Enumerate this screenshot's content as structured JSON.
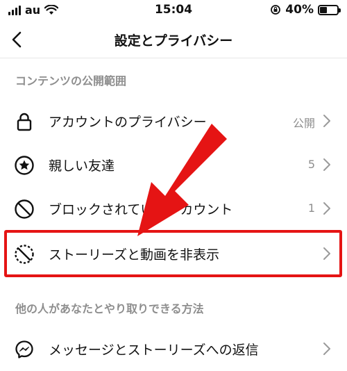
{
  "status_bar": {
    "carrier": "au",
    "time": "15:04",
    "battery_percent": "40%",
    "battery_level": 0.4
  },
  "nav": {
    "title": "設定とプライバシー",
    "back_icon": "chevron-left-icon"
  },
  "sections": [
    {
      "header": "コンテンツの公開範囲",
      "items": [
        {
          "label": "アカウントのプライバシー",
          "value": "公開",
          "icon": "lock-icon"
        },
        {
          "label": "親しい友達",
          "value": "5",
          "icon": "star-circle-icon"
        },
        {
          "label": "ブロックされているアカウント",
          "value": "1",
          "icon": "block-icon"
        },
        {
          "label": "ストーリーズと動画を非表示",
          "value": "",
          "icon": "hide-story-icon"
        }
      ]
    },
    {
      "header": "他の人があなたとやり取りできる方法",
      "items": [
        {
          "label": "メッセージとストーリーズへの返信",
          "value": "",
          "icon": "messenger-icon"
        }
      ]
    }
  ],
  "colors": {
    "annotation_red": "#e51414",
    "secondary_text": "#8e8e8e"
  }
}
